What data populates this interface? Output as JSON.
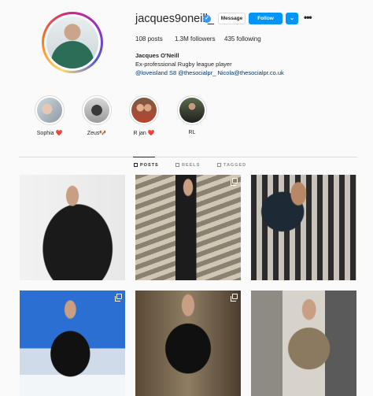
{
  "profile": {
    "username": "jacques9oneill_",
    "verified_mark": "✓",
    "buttons": {
      "message": "Message",
      "follow": "Follow",
      "dropdown": "⌄",
      "more": "•••"
    },
    "stats": {
      "posts": "108 posts",
      "followers": "1.3M followers",
      "following": "435 following"
    },
    "full_name": "Jacques O'Neill",
    "bio": "Ex-professional Rugby league player",
    "bio_link": "@loveisland S8 @thesocialpr_ Nicola@thesocialpr.co.uk"
  },
  "highlights": [
    {
      "label": "Sophia ❤️",
      "color": "#b8c4cc"
    },
    {
      "label": "Zeus🐶",
      "color": "#8a8a8a"
    },
    {
      "label": "R jan ❤️",
      "color": "#c4703f"
    },
    {
      "label": "RL",
      "color": "#2c2c2c"
    }
  ],
  "tabs": [
    {
      "label": "POSTS",
      "active": true
    },
    {
      "label": "REELS",
      "active": false
    },
    {
      "label": "TAGGED",
      "active": false
    }
  ],
  "posts": [
    {
      "kind": "photo-black-jacket",
      "multi": false
    },
    {
      "kind": "photo-suit-staircase",
      "multi": true
    },
    {
      "kind": "photo-plaid-jacket",
      "multi": false
    },
    {
      "kind": "photo-blue-sky-puffer",
      "multi": true
    },
    {
      "kind": "photo-black-tshirt",
      "multi": true
    },
    {
      "kind": "photo-chair-blazer",
      "multi": false
    }
  ],
  "colors": {
    "accent": "#0095f6",
    "verified": "#3897f0",
    "link": "#00376b"
  }
}
